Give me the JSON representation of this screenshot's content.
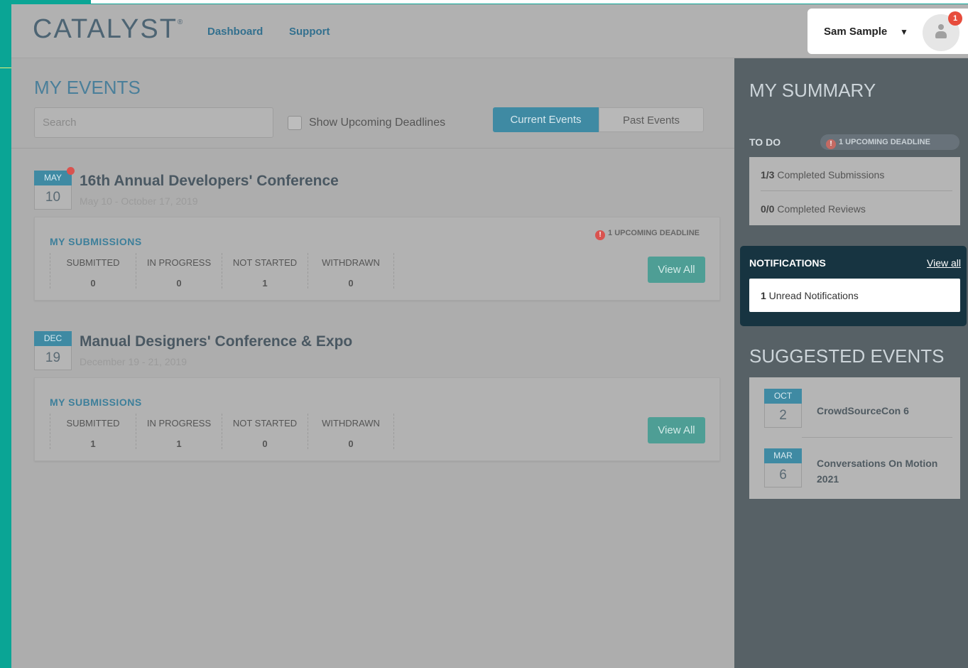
{
  "brand": {
    "logo": "CATALYST",
    "reg": "®"
  },
  "nav": {
    "dashboard": "Dashboard",
    "support": "Support"
  },
  "user": {
    "name": "Sam Sample",
    "caret": "▼",
    "badge_count": "1"
  },
  "main": {
    "title": "MY EVENTS",
    "search_placeholder": "Search",
    "checkbox_label": "Show Upcoming Deadlines",
    "toggle_current": "Current Events",
    "toggle_past": "Past Events"
  },
  "events": [
    {
      "month": "MAY",
      "day": "10",
      "title": "16th Annual Developers' Conference",
      "dates": "May 10 - October 17, 2019",
      "submissions_label": "MY SUBMISSIONS",
      "deadline_icon": "!",
      "deadline": "1 UPCOMING DEADLINE",
      "stats": [
        {
          "label": "SUBMITTED",
          "value": "0"
        },
        {
          "label": "IN PROGRESS",
          "value": "0"
        },
        {
          "label": "NOT STARTED",
          "value": "1"
        },
        {
          "label": "WITHDRAWN",
          "value": "0"
        }
      ],
      "view_all": "View All"
    },
    {
      "month": "DEC",
      "day": "19",
      "title": "Manual Designers' Conference & Expo",
      "dates": "December 19 - 21, 2019",
      "submissions_label": "MY SUBMISSIONS",
      "stats": [
        {
          "label": "SUBMITTED",
          "value": "1"
        },
        {
          "label": "IN PROGRESS",
          "value": "1"
        },
        {
          "label": "NOT STARTED",
          "value": "0"
        },
        {
          "label": "WITHDRAWN",
          "value": "0"
        }
      ],
      "view_all": "View All"
    }
  ],
  "summary": {
    "title": "MY SUMMARY",
    "todo_label": "TO DO",
    "todo_icon": "!",
    "todo_deadline": "1 UPCOMING DEADLINE",
    "submissions_count": "1/3",
    "submissions_text": " Completed Submissions",
    "reviews_count": "0/0",
    "reviews_text": " Completed Reviews"
  },
  "notifications": {
    "title": "NOTIFICATIONS",
    "view_all": "View all",
    "unread_count": "1",
    "unread_text": " Unread Notifications"
  },
  "suggested": {
    "title": "SUGGESTED EVENTS",
    "items": [
      {
        "month": "OCT",
        "day": "2",
        "name": "CrowdSourceCon 6"
      },
      {
        "month": "MAR",
        "day": "6",
        "name": "Conversations On Motion 2021"
      }
    ]
  },
  "colors": {
    "accent": "#3f8aa3",
    "teal_frame": "#0aa595",
    "sidebar": "#576166",
    "notif_panel": "#173441",
    "deadline_red": "#d9534f"
  },
  "icons": {
    "avatar": "user-icon",
    "dropdown": "chevron-down-icon",
    "alert": "alert-icon"
  }
}
